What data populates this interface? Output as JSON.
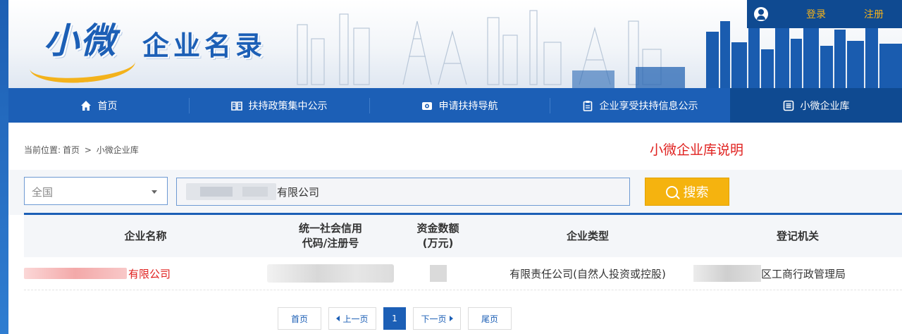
{
  "header": {
    "logo_text": "小微",
    "site_name": "企业名录",
    "login_label": "登录",
    "register_label": "注册"
  },
  "nav": {
    "items": [
      {
        "label": "首页",
        "icon": "home-icon"
      },
      {
        "label": "扶持政策集中公示",
        "icon": "book-icon"
      },
      {
        "label": "申请扶持导航",
        "icon": "camera-icon"
      },
      {
        "label": "企业享受扶持信息公示",
        "icon": "clipboard-icon"
      },
      {
        "label": "小微企业库",
        "icon": "list-icon",
        "active": true
      }
    ]
  },
  "breadcrumb": {
    "prefix": "当前位置:",
    "home": "首页",
    "separator": ">",
    "current": "小微企业库"
  },
  "explain_link": "小微企业库说明",
  "search": {
    "region_value": "全国",
    "query_value": "有限公司",
    "button_label": "搜索"
  },
  "table": {
    "headers": {
      "name": "企业名称",
      "credit_line1": "统一社会信用",
      "credit_line2": "代码/注册号",
      "capital_line1": "资金数额",
      "capital_line2": "(万元)",
      "type": "企业类型",
      "org": "登记机关"
    },
    "rows": [
      {
        "name_suffix": "有限公司",
        "type": "有限责任公司(自然人投资或控股)",
        "org_suffix": "区工商行政管理局"
      }
    ]
  },
  "pager": {
    "first": "首页",
    "prev": "上一页",
    "current": "1",
    "next": "下一页",
    "last": "尾页"
  },
  "colors": {
    "brand_blue": "#1c5fb6",
    "nav_active": "#0f4a91",
    "accent_red": "#e0201e",
    "search_orange": "#f5b30f"
  }
}
